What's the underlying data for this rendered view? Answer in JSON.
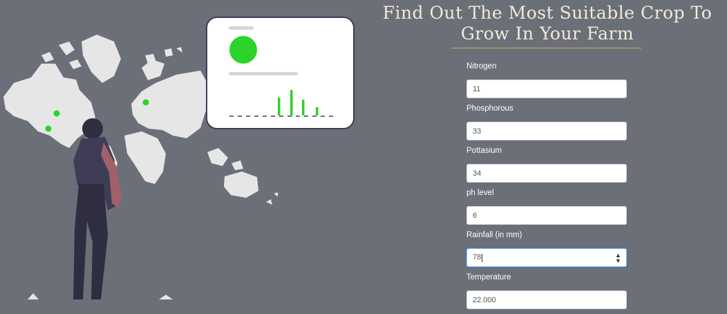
{
  "header": {
    "title_line1": "Find Out The Most Suitable Crop To",
    "title_line2": "Grow In Your Farm"
  },
  "form": {
    "fields": [
      {
        "label": "Nitrogen",
        "value": "11"
      },
      {
        "label": "Phosphorous",
        "value": "33"
      },
      {
        "label": "Pottasium",
        "value": "34"
      },
      {
        "label": "ph level",
        "value": "6"
      },
      {
        "label": "Rainfall (in mm)",
        "value": "78"
      },
      {
        "label": "Temperature",
        "value": "22.000"
      }
    ]
  },
  "colors": {
    "background": "#6b6f78",
    "title": "#f3ead6",
    "accent_green": "#2bd32b",
    "map": "#e6e6e6"
  },
  "icons": [
    "spinner-arrows-icon"
  ]
}
